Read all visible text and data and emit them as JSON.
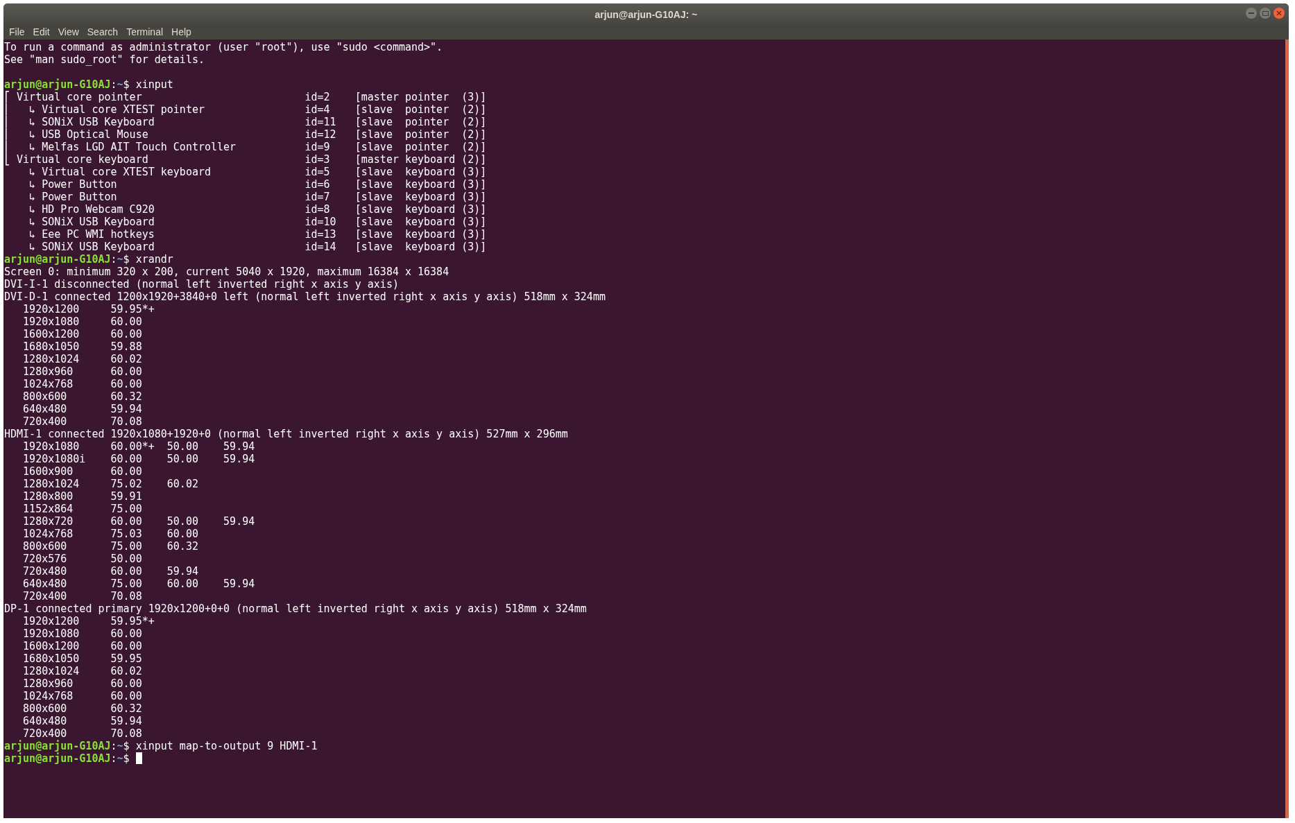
{
  "window": {
    "title": "arjun@arjun-G10AJ: ~"
  },
  "menu": [
    "File",
    "Edit",
    "View",
    "Search",
    "Terminal",
    "Help"
  ],
  "terminal": {
    "lines": [
      {
        "kind": "output",
        "text": "To run a command as administrator (user \"root\"), use \"sudo <command>\"."
      },
      {
        "kind": "output",
        "text": "See \"man sudo_root\" for details."
      },
      {
        "kind": "blank"
      },
      {
        "kind": "prompt",
        "user": "arjun@arjun-G10AJ",
        "colon": ":",
        "path": "~",
        "dollar": "$",
        "command": " xinput",
        "cursor": false
      },
      {
        "kind": "output",
        "text": "⎡ Virtual core pointer                          id=2    [master pointer  (3)]"
      },
      {
        "kind": "output",
        "text": "⎜   ↳ Virtual core XTEST pointer                id=4    [slave  pointer  (2)]"
      },
      {
        "kind": "output",
        "text": "⎜   ↳ SONiX USB Keyboard                        id=11   [slave  pointer  (2)]"
      },
      {
        "kind": "output",
        "text": "⎜   ↳ USB Optical Mouse                         id=12   [slave  pointer  (2)]"
      },
      {
        "kind": "output",
        "text": "⎜   ↳ Melfas LGD AIT Touch Controller           id=9    [slave  pointer  (2)]"
      },
      {
        "kind": "output",
        "text": "⎣ Virtual core keyboard                         id=3    [master keyboard (2)]"
      },
      {
        "kind": "output",
        "text": "    ↳ Virtual core XTEST keyboard               id=5    [slave  keyboard (3)]"
      },
      {
        "kind": "output",
        "text": "    ↳ Power Button                              id=6    [slave  keyboard (3)]"
      },
      {
        "kind": "output",
        "text": "    ↳ Power Button                              id=7    [slave  keyboard (3)]"
      },
      {
        "kind": "output",
        "text": "    ↳ HD Pro Webcam C920                        id=8    [slave  keyboard (3)]"
      },
      {
        "kind": "output",
        "text": "    ↳ SONiX USB Keyboard                        id=10   [slave  keyboard (3)]"
      },
      {
        "kind": "output",
        "text": "    ↳ Eee PC WMI hotkeys                        id=13   [slave  keyboard (3)]"
      },
      {
        "kind": "output",
        "text": "    ↳ SONiX USB Keyboard                        id=14   [slave  keyboard (3)]"
      },
      {
        "kind": "prompt",
        "user": "arjun@arjun-G10AJ",
        "colon": ":",
        "path": "~",
        "dollar": "$",
        "command": " xrandr",
        "cursor": false
      },
      {
        "kind": "output",
        "text": "Screen 0: minimum 320 x 200, current 5040 x 1920, maximum 16384 x 16384"
      },
      {
        "kind": "output",
        "text": "DVI-I-1 disconnected (normal left inverted right x axis y axis)"
      },
      {
        "kind": "output",
        "text": "DVI-D-1 connected 1200x1920+3840+0 left (normal left inverted right x axis y axis) 518mm x 324mm"
      },
      {
        "kind": "output",
        "text": "   1920x1200     59.95*+"
      },
      {
        "kind": "output",
        "text": "   1920x1080     60.00"
      },
      {
        "kind": "output",
        "text": "   1600x1200     60.00"
      },
      {
        "kind": "output",
        "text": "   1680x1050     59.88"
      },
      {
        "kind": "output",
        "text": "   1280x1024     60.02"
      },
      {
        "kind": "output",
        "text": "   1280x960      60.00"
      },
      {
        "kind": "output",
        "text": "   1024x768      60.00"
      },
      {
        "kind": "output",
        "text": "   800x600       60.32"
      },
      {
        "kind": "output",
        "text": "   640x480       59.94"
      },
      {
        "kind": "output",
        "text": "   720x400       70.08"
      },
      {
        "kind": "output",
        "text": "HDMI-1 connected 1920x1080+1920+0 (normal left inverted right x axis y axis) 527mm x 296mm"
      },
      {
        "kind": "output",
        "text": "   1920x1080     60.00*+  50.00    59.94"
      },
      {
        "kind": "output",
        "text": "   1920x1080i    60.00    50.00    59.94"
      },
      {
        "kind": "output",
        "text": "   1600x900      60.00"
      },
      {
        "kind": "output",
        "text": "   1280x1024     75.02    60.02"
      },
      {
        "kind": "output",
        "text": "   1280x800      59.91"
      },
      {
        "kind": "output",
        "text": "   1152x864      75.00"
      },
      {
        "kind": "output",
        "text": "   1280x720      60.00    50.00    59.94"
      },
      {
        "kind": "output",
        "text": "   1024x768      75.03    60.00"
      },
      {
        "kind": "output",
        "text": "   800x600       75.00    60.32"
      },
      {
        "kind": "output",
        "text": "   720x576       50.00"
      },
      {
        "kind": "output",
        "text": "   720x480       60.00    59.94"
      },
      {
        "kind": "output",
        "text": "   640x480       75.00    60.00    59.94"
      },
      {
        "kind": "output",
        "text": "   720x400       70.08"
      },
      {
        "kind": "output",
        "text": "DP-1 connected primary 1920x1200+0+0 (normal left inverted right x axis y axis) 518mm x 324mm"
      },
      {
        "kind": "output",
        "text": "   1920x1200     59.95*+"
      },
      {
        "kind": "output",
        "text": "   1920x1080     60.00"
      },
      {
        "kind": "output",
        "text": "   1600x1200     60.00"
      },
      {
        "kind": "output",
        "text": "   1680x1050     59.95"
      },
      {
        "kind": "output",
        "text": "   1280x1024     60.02"
      },
      {
        "kind": "output",
        "text": "   1280x960      60.00"
      },
      {
        "kind": "output",
        "text": "   1024x768      60.00"
      },
      {
        "kind": "output",
        "text": "   800x600       60.32"
      },
      {
        "kind": "output",
        "text": "   640x480       59.94"
      },
      {
        "kind": "output",
        "text": "   720x400       70.08"
      },
      {
        "kind": "prompt",
        "user": "arjun@arjun-G10AJ",
        "colon": ":",
        "path": "~",
        "dollar": "$",
        "command": " xinput map-to-output 9 HDMI-1",
        "cursor": false
      },
      {
        "kind": "prompt",
        "user": "arjun@arjun-G10AJ",
        "colon": ":",
        "path": "~",
        "dollar": "$",
        "cursor": true
      }
    ]
  }
}
